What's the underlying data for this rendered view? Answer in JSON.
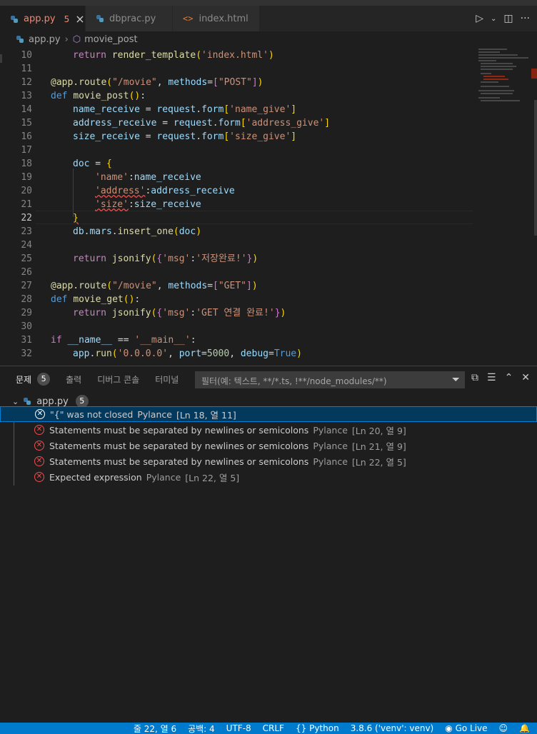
{
  "tabs": [
    {
      "label": "app.py",
      "badge": "5",
      "active": true
    },
    {
      "label": "dbprac.py",
      "active": false
    },
    {
      "label": "index.html",
      "active": false
    }
  ],
  "breadcrumb": {
    "file": "app.py",
    "symbol": "movie_post"
  },
  "editor": {
    "current_line": "22",
    "lines": [
      {
        "n": "10"
      },
      {
        "n": "11"
      },
      {
        "n": "12"
      },
      {
        "n": "13"
      },
      {
        "n": "14"
      },
      {
        "n": "15"
      },
      {
        "n": "16"
      },
      {
        "n": "17"
      },
      {
        "n": "18"
      },
      {
        "n": "19"
      },
      {
        "n": "20"
      },
      {
        "n": "21"
      },
      {
        "n": "22"
      },
      {
        "n": "23"
      },
      {
        "n": "24"
      },
      {
        "n": "25"
      },
      {
        "n": "26"
      },
      {
        "n": "27"
      },
      {
        "n": "28"
      },
      {
        "n": "29"
      },
      {
        "n": "30"
      },
      {
        "n": "31"
      },
      {
        "n": "32"
      }
    ],
    "code": {
      "l10_a": "return",
      "l10_b": "render_template",
      "l10_c": "'index.html'",
      "l12_a": "@app.route",
      "l12_b": "\"/movie\"",
      "l12_c": "methods",
      "l12_d": "\"POST\"",
      "l13_a": "def",
      "l13_b": "movie_post",
      "l14_a": "name_receive",
      "l14_b": "request",
      "l14_c": "form",
      "l14_d": "'name_give'",
      "l15_a": "address_receive",
      "l15_b": "request",
      "l15_c": "form",
      "l15_d": "'address_give'",
      "l16_a": "size_receive",
      "l16_b": "request",
      "l16_c": "form",
      "l16_d": "'size_give'",
      "l18_a": "doc",
      "l19_a": "'name'",
      "l19_b": "name_receive",
      "l20_a": "'address'",
      "l20_b": "address_receive",
      "l21_a": "'size'",
      "l21_b": "size_receive",
      "l23_a": "db",
      "l23_b": "mars",
      "l23_c": "insert_one",
      "l23_d": "doc",
      "l25_a": "return",
      "l25_b": "jsonify",
      "l25_c": "'msg'",
      "l25_d": "'저장완료!'",
      "l27_a": "@app.route",
      "l27_b": "\"/movie\"",
      "l27_c": "methods",
      "l27_d": "\"GET\"",
      "l28_a": "def",
      "l28_b": "movie_get",
      "l29_a": "return",
      "l29_b": "jsonify",
      "l29_c": "'msg'",
      "l29_d": "'GET 연결 완료!'",
      "l31_a": "if",
      "l31_b": "__name__",
      "l31_c": "'__main__'",
      "l32_a": "app",
      "l32_b": "run",
      "l32_c": "'0.0.0.0'",
      "l32_d": "port",
      "l32_e": "5000",
      "l32_f": "debug",
      "l32_g": "True"
    }
  },
  "panel": {
    "tabs": [
      {
        "label": "문제",
        "count": "5"
      },
      {
        "label": "출력"
      },
      {
        "label": "디버그 콘솔"
      },
      {
        "label": "터미널"
      }
    ],
    "filter_placeholder": "필터(예: 텍스트, **/*.ts, !**/node_modules/**)",
    "file": {
      "name": "app.py",
      "count": "5"
    },
    "problems": [
      {
        "message": "\"{\" was not closed",
        "source": "Pylance",
        "location": "[Ln 18, 열 11]"
      },
      {
        "message": "Statements must be separated by newlines or semicolons",
        "source": "Pylance",
        "location": "[Ln 20, 열 9]"
      },
      {
        "message": "Statements must be separated by newlines or semicolons",
        "source": "Pylance",
        "location": "[Ln 21, 열 9]"
      },
      {
        "message": "Statements must be separated by newlines or semicolons",
        "source": "Pylance",
        "location": "[Ln 22, 열 5]"
      },
      {
        "message": "Expected expression",
        "source": "Pylance",
        "location": "[Ln 22, 열 5]"
      }
    ]
  },
  "statusbar": {
    "position": "줄 22, 열 6",
    "spaces": "공백: 4",
    "encoding": "UTF-8",
    "eol": "CRLF",
    "language": "Python",
    "interpreter": "3.8.6 ('venv': venv)",
    "golive": "Go Live"
  }
}
